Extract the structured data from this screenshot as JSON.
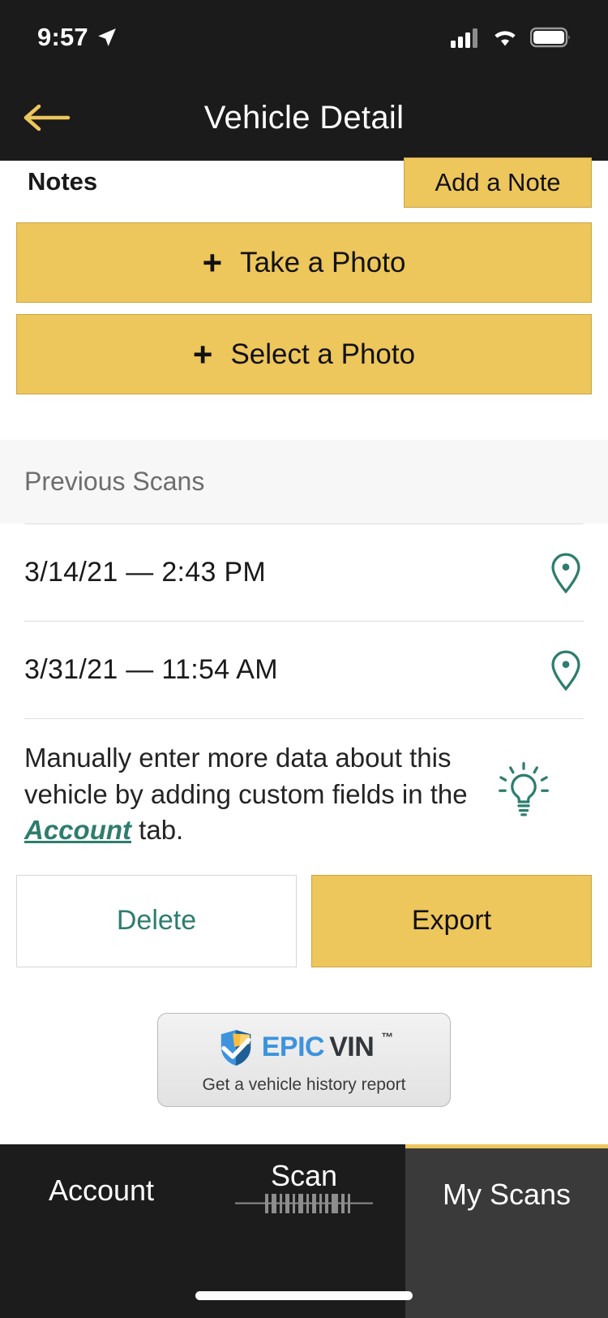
{
  "status_bar": {
    "time": "9:57",
    "location_icon": "location-arrow-icon",
    "cellular_icon": "cellular-signal-icon",
    "wifi_icon": "wifi-icon",
    "battery_icon": "battery-full-icon"
  },
  "nav": {
    "back_icon": "back-arrow-icon",
    "title": "Vehicle Detail"
  },
  "notes": {
    "label": "Notes",
    "add_button": "Add a Note"
  },
  "photos": {
    "take_plus": "+",
    "take_label": "Take a Photo",
    "select_plus": "+",
    "select_label": "Select a Photo"
  },
  "previous_scans": {
    "header": "Previous Scans",
    "rows": [
      {
        "date": "3/14/21 — 2:43 PM",
        "icon": "map-pin-icon"
      },
      {
        "date": "3/31/21 — 11:54 AM",
        "icon": "map-pin-icon"
      }
    ]
  },
  "tip": {
    "text_before": "Manually enter more data about this vehicle by adding custom fields in the ",
    "link": "Account",
    "text_after": " tab.",
    "icon": "lightbulb-icon"
  },
  "actions": {
    "delete_label": "Delete",
    "export_label": "Export"
  },
  "epicvin": {
    "logo_icon": "epicvin-shield-check-icon",
    "word_primary": "EPIC",
    "word_secondary": "VIN",
    "trademark": "™",
    "tagline": "Get a vehicle history report"
  },
  "tabs": [
    {
      "label": "Account",
      "active": false,
      "icon": "account-tab"
    },
    {
      "label": "Scan",
      "active": false,
      "icon": "barcode-icon"
    },
    {
      "label": "My Scans",
      "active": true,
      "icon": "my-scans-tab"
    }
  ],
  "colors": {
    "accent_yellow": "#edc65c",
    "accent_yellow_border": "#c9a544",
    "teal": "#2e7d6e",
    "nav_bg": "#1b1b1b",
    "tab_bg": "#1c1c1c",
    "tab_active_bg": "#3a3a3a",
    "section_bg": "#f7f7f7",
    "epic_blue": "#3d93dd",
    "epic_dark": "#33373b"
  }
}
